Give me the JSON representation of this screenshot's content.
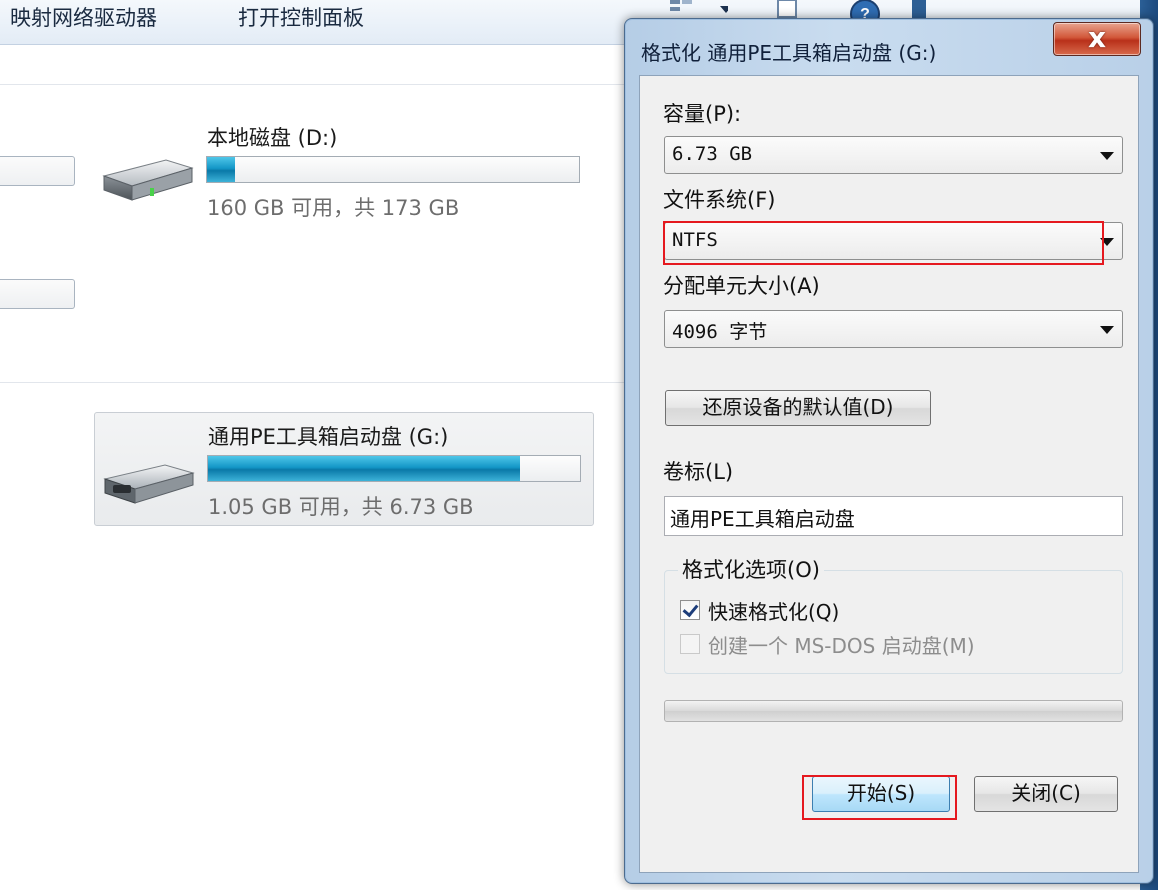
{
  "toolbar": {
    "items": [
      "映射网络驱动器",
      "打开控制面板"
    ]
  },
  "drives": [
    {
      "name": "本地磁盘 (D:)",
      "free_text": "160 GB 可用，共 173 GB",
      "used_fraction": 0.075,
      "selected": false
    },
    {
      "name": "通用PE工具箱启动盘 (G:)",
      "free_text": "1.05 GB 可用，共 6.73 GB",
      "used_fraction": 0.84,
      "selected": true
    }
  ],
  "dialog": {
    "title": "格式化 通用PE工具箱启动盘 (G:)",
    "close_glyph": "x",
    "capacity": {
      "label": "容量(P):",
      "value": "6.73 GB"
    },
    "filesystem": {
      "label": "文件系统(F)",
      "value": "NTFS"
    },
    "allocation": {
      "label": "分配单元大小(A)",
      "value": "4096 字节"
    },
    "restore_button": "还原设备的默认值(D)",
    "volume": {
      "label": "卷标(L)",
      "value": "通用PE工具箱启动盘"
    },
    "options": {
      "title": "格式化选项(O)",
      "quick_format": {
        "label": "快速格式化(Q)",
        "checked": true
      },
      "msdos_boot": {
        "label": "创建一个 MS-DOS 启动盘(M)",
        "checked": false,
        "disabled": true
      }
    },
    "progress": 0,
    "start_button": "开始(S)",
    "close_button": "关闭(C)"
  },
  "colors": {
    "highlight": "#e5191f",
    "drive_bar": "#1497c7"
  }
}
